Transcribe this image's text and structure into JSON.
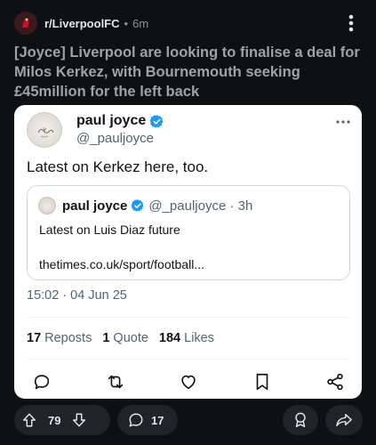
{
  "post": {
    "subreddit": "r/LiverpoolFC",
    "separator": "•",
    "age": "6m",
    "title": "[Joyce] Liverpool are looking to finalise a deal for Milos Kerkez, with Bournemouth seeking £45million for the left back"
  },
  "tweet": {
    "author_name": "paul joyce",
    "author_handle": "@_pauljoyce",
    "text": "Latest on Kerkez here, too.",
    "timestamp": "15:02 · 04 Jun 25",
    "quote": {
      "author_name": "paul joyce",
      "author_handle_time": "@_pauljoyce · 3h",
      "line1": "Latest on Luis Diaz future",
      "line2": "thetimes.co.uk/sport/football..."
    },
    "stats": {
      "reposts_count": "17",
      "reposts_label": "Reposts",
      "quotes_count": "1",
      "quotes_label": "Quote",
      "likes_count": "184",
      "likes_label": "Likes"
    }
  },
  "actions": {
    "upvotes": "79",
    "comments": "17"
  },
  "icons": {
    "more": "more-vertical-icon",
    "verified": "verified-badge-icon",
    "reply": "reply-icon",
    "repost": "repost-icon",
    "like": "heart-icon",
    "bookmark": "bookmark-icon",
    "share": "share-nodes-icon",
    "upvote": "upvote-arrow-icon",
    "downvote": "downvote-arrow-icon",
    "comment": "comment-bubble-icon",
    "award": "award-icon",
    "share_post": "share-arrow-icon"
  },
  "colors": {
    "background": "#0e1113",
    "verified_blue": "#1d9bf0",
    "pill": "#1e2427",
    "card": "#ffffff"
  }
}
